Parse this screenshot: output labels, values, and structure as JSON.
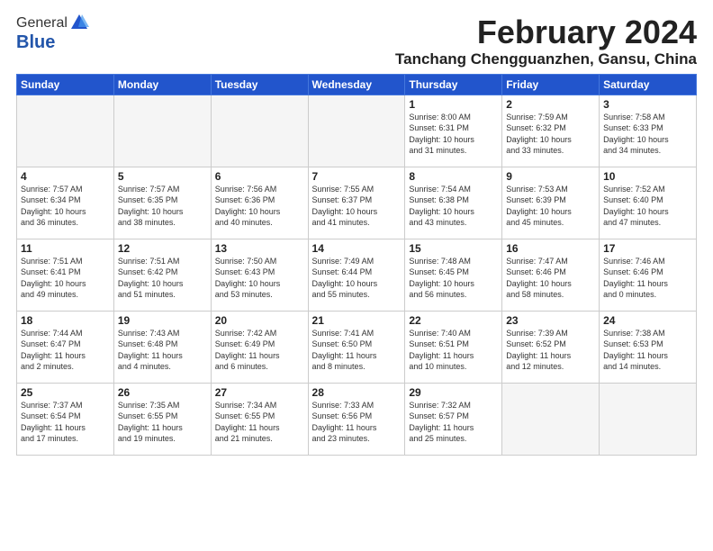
{
  "header": {
    "logo_general": "General",
    "logo_blue": "Blue",
    "month_title": "February 2024",
    "location": "Tanchang Chengguanzhen, Gansu, China"
  },
  "weekdays": [
    "Sunday",
    "Monday",
    "Tuesday",
    "Wednesday",
    "Thursday",
    "Friday",
    "Saturday"
  ],
  "weeks": [
    [
      {
        "day": "",
        "info": ""
      },
      {
        "day": "",
        "info": ""
      },
      {
        "day": "",
        "info": ""
      },
      {
        "day": "",
        "info": ""
      },
      {
        "day": "1",
        "info": "Sunrise: 8:00 AM\nSunset: 6:31 PM\nDaylight: 10 hours\nand 31 minutes."
      },
      {
        "day": "2",
        "info": "Sunrise: 7:59 AM\nSunset: 6:32 PM\nDaylight: 10 hours\nand 33 minutes."
      },
      {
        "day": "3",
        "info": "Sunrise: 7:58 AM\nSunset: 6:33 PM\nDaylight: 10 hours\nand 34 minutes."
      }
    ],
    [
      {
        "day": "4",
        "info": "Sunrise: 7:57 AM\nSunset: 6:34 PM\nDaylight: 10 hours\nand 36 minutes."
      },
      {
        "day": "5",
        "info": "Sunrise: 7:57 AM\nSunset: 6:35 PM\nDaylight: 10 hours\nand 38 minutes."
      },
      {
        "day": "6",
        "info": "Sunrise: 7:56 AM\nSunset: 6:36 PM\nDaylight: 10 hours\nand 40 minutes."
      },
      {
        "day": "7",
        "info": "Sunrise: 7:55 AM\nSunset: 6:37 PM\nDaylight: 10 hours\nand 41 minutes."
      },
      {
        "day": "8",
        "info": "Sunrise: 7:54 AM\nSunset: 6:38 PM\nDaylight: 10 hours\nand 43 minutes."
      },
      {
        "day": "9",
        "info": "Sunrise: 7:53 AM\nSunset: 6:39 PM\nDaylight: 10 hours\nand 45 minutes."
      },
      {
        "day": "10",
        "info": "Sunrise: 7:52 AM\nSunset: 6:40 PM\nDaylight: 10 hours\nand 47 minutes."
      }
    ],
    [
      {
        "day": "11",
        "info": "Sunrise: 7:51 AM\nSunset: 6:41 PM\nDaylight: 10 hours\nand 49 minutes."
      },
      {
        "day": "12",
        "info": "Sunrise: 7:51 AM\nSunset: 6:42 PM\nDaylight: 10 hours\nand 51 minutes."
      },
      {
        "day": "13",
        "info": "Sunrise: 7:50 AM\nSunset: 6:43 PM\nDaylight: 10 hours\nand 53 minutes."
      },
      {
        "day": "14",
        "info": "Sunrise: 7:49 AM\nSunset: 6:44 PM\nDaylight: 10 hours\nand 55 minutes."
      },
      {
        "day": "15",
        "info": "Sunrise: 7:48 AM\nSunset: 6:45 PM\nDaylight: 10 hours\nand 56 minutes."
      },
      {
        "day": "16",
        "info": "Sunrise: 7:47 AM\nSunset: 6:46 PM\nDaylight: 10 hours\nand 58 minutes."
      },
      {
        "day": "17",
        "info": "Sunrise: 7:46 AM\nSunset: 6:46 PM\nDaylight: 11 hours\nand 0 minutes."
      }
    ],
    [
      {
        "day": "18",
        "info": "Sunrise: 7:44 AM\nSunset: 6:47 PM\nDaylight: 11 hours\nand 2 minutes."
      },
      {
        "day": "19",
        "info": "Sunrise: 7:43 AM\nSunset: 6:48 PM\nDaylight: 11 hours\nand 4 minutes."
      },
      {
        "day": "20",
        "info": "Sunrise: 7:42 AM\nSunset: 6:49 PM\nDaylight: 11 hours\nand 6 minutes."
      },
      {
        "day": "21",
        "info": "Sunrise: 7:41 AM\nSunset: 6:50 PM\nDaylight: 11 hours\nand 8 minutes."
      },
      {
        "day": "22",
        "info": "Sunrise: 7:40 AM\nSunset: 6:51 PM\nDaylight: 11 hours\nand 10 minutes."
      },
      {
        "day": "23",
        "info": "Sunrise: 7:39 AM\nSunset: 6:52 PM\nDaylight: 11 hours\nand 12 minutes."
      },
      {
        "day": "24",
        "info": "Sunrise: 7:38 AM\nSunset: 6:53 PM\nDaylight: 11 hours\nand 14 minutes."
      }
    ],
    [
      {
        "day": "25",
        "info": "Sunrise: 7:37 AM\nSunset: 6:54 PM\nDaylight: 11 hours\nand 17 minutes."
      },
      {
        "day": "26",
        "info": "Sunrise: 7:35 AM\nSunset: 6:55 PM\nDaylight: 11 hours\nand 19 minutes."
      },
      {
        "day": "27",
        "info": "Sunrise: 7:34 AM\nSunset: 6:55 PM\nDaylight: 11 hours\nand 21 minutes."
      },
      {
        "day": "28",
        "info": "Sunrise: 7:33 AM\nSunset: 6:56 PM\nDaylight: 11 hours\nand 23 minutes."
      },
      {
        "day": "29",
        "info": "Sunrise: 7:32 AM\nSunset: 6:57 PM\nDaylight: 11 hours\nand 25 minutes."
      },
      {
        "day": "",
        "info": ""
      },
      {
        "day": "",
        "info": ""
      }
    ]
  ]
}
